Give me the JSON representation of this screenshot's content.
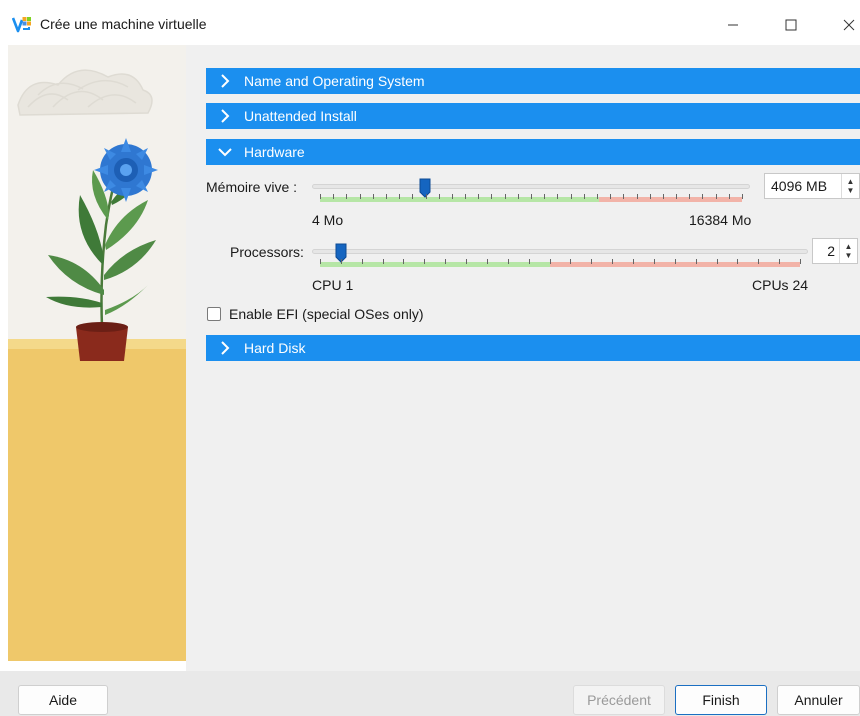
{
  "window": {
    "title": "Crée une machine virtuelle",
    "minimize": "—",
    "maximize": "☐",
    "close": "✕"
  },
  "sections": {
    "name_os": "Name and Operating System",
    "unattended": "Unattended Install",
    "hardware": "Hardware",
    "hard_disk": "Hard Disk"
  },
  "hardware": {
    "memory": {
      "label": "Mémoire vive :",
      "value": "4096 MB",
      "min_label": "4 Mo",
      "max_label": "16384 Mo",
      "min": 4,
      "max": 16384,
      "current": 4096,
      "recommended_max_fraction": 0.66
    },
    "processors": {
      "label": "Processors:",
      "value": "2",
      "min_label": "CPU 1",
      "max_label": "CPUs 24",
      "min": 1,
      "max": 24,
      "current": 2,
      "recommended_max_fraction": 0.48
    },
    "efi": {
      "label": "Enable EFI (special OSes only)",
      "checked": false
    }
  },
  "buttons": {
    "help": "Aide",
    "previous": "Précédent",
    "finish": "Finish",
    "cancel": "Annuler"
  },
  "colors": {
    "accent": "#1b8fef",
    "slider_ok": "#b6e6a6",
    "slider_warn": "#f2b3a8",
    "handle": "#1565c0"
  }
}
